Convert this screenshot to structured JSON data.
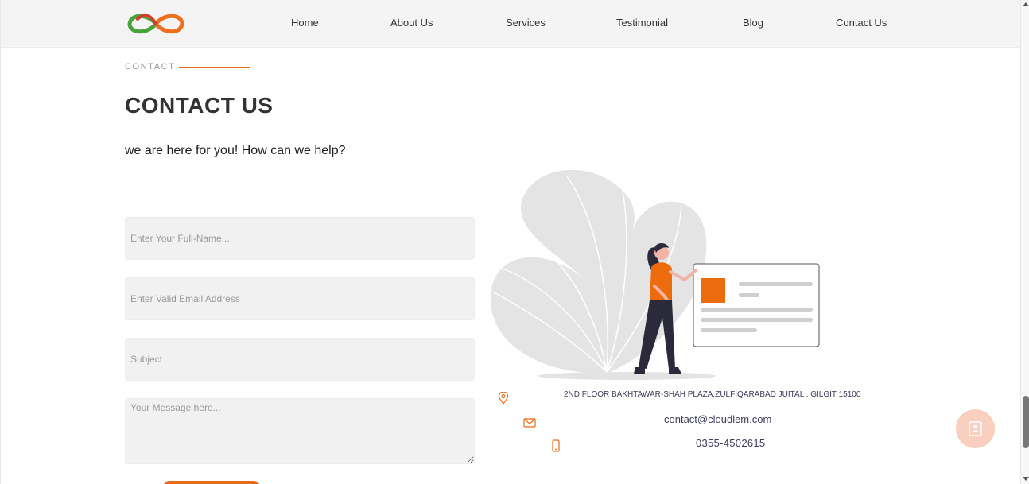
{
  "header": {
    "nav": [
      {
        "label": "Home"
      },
      {
        "label": "About Us"
      },
      {
        "label": "Services"
      },
      {
        "label": "Testimonial"
      },
      {
        "label": "Blog"
      },
      {
        "label": "Contact Us"
      }
    ],
    "logo_icon": "infinity-logo-icon"
  },
  "section": {
    "eyebrow": "CONTACT",
    "title": "CONTACT US",
    "subtitle": "we are here for you! How can we help?"
  },
  "form": {
    "name_placeholder": "Enter Your Full-Name...",
    "email_placeholder": "Enter Valid Email Address",
    "subject_placeholder": "Subject",
    "message_placeholder": "Your Message here..."
  },
  "contact_info": {
    "address": "2ND FLOOR BAKHTAWAR-SHAH PLAZA,ZULFIQARABAD JUITAL , GILGIT 15100",
    "email": "contact@cloudlem.com",
    "phone": "0355-4502615"
  },
  "colors": {
    "accent": "#e96b17",
    "text_dark": "#333333",
    "field_bg": "#f1f1f1"
  },
  "fab": {
    "icon": "contact-card-icon"
  }
}
